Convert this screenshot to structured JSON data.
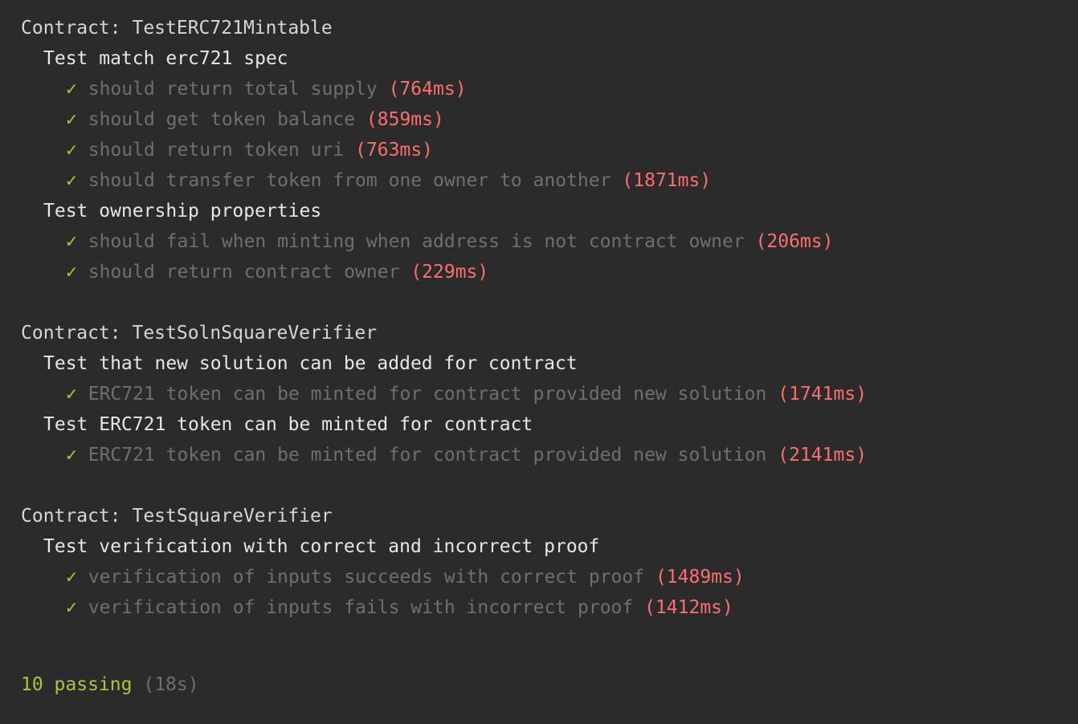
{
  "contracts": [
    {
      "title": "Contract: TestERC721Mintable",
      "suites": [
        {
          "title": "Test match erc721 spec",
          "tests": [
            {
              "mark": "✓",
              "title": "should return total supply",
              "duration": "(764ms)"
            },
            {
              "mark": "✓",
              "title": "should get token balance",
              "duration": "(859ms)"
            },
            {
              "mark": "✓",
              "title": "should return token uri",
              "duration": "(763ms)"
            },
            {
              "mark": "✓",
              "title": "should transfer token from one owner to another",
              "duration": "(1871ms)"
            }
          ]
        },
        {
          "title": "Test ownership properties",
          "tests": [
            {
              "mark": "✓",
              "title": "should fail when minting when address is not contract owner",
              "duration": "(206ms)"
            },
            {
              "mark": "✓",
              "title": "should return contract owner",
              "duration": "(229ms)"
            }
          ]
        }
      ]
    },
    {
      "title": "Contract: TestSolnSquareVerifier",
      "suites": [
        {
          "title": "Test that new solution can be added for contract",
          "tests": [
            {
              "mark": "✓",
              "title": "ERC721 token can be minted for contract provided new solution",
              "duration": "(1741ms)"
            }
          ]
        },
        {
          "title": "Test ERC721 token can be minted for contract",
          "tests": [
            {
              "mark": "✓",
              "title": "ERC721 token can be minted for contract provided new solution",
              "duration": "(2141ms)"
            }
          ]
        }
      ]
    },
    {
      "title": "Contract: TestSquareVerifier",
      "suites": [
        {
          "title": "Test verification with correct and incorrect proof",
          "tests": [
            {
              "mark": "✓",
              "title": "verification of inputs succeeds with correct proof",
              "duration": "(1489ms)"
            },
            {
              "mark": "✓",
              "title": "verification of inputs fails with incorrect proof",
              "duration": "(1412ms)"
            }
          ]
        }
      ]
    }
  ],
  "summary": {
    "passing": "10 passing",
    "total_time": "(18s)"
  },
  "colors": {
    "background": "#2b2b2b",
    "pass_green": "#a6c83b",
    "duration_red": "#ff6e6e",
    "muted_gray": "#6f6f6f"
  }
}
